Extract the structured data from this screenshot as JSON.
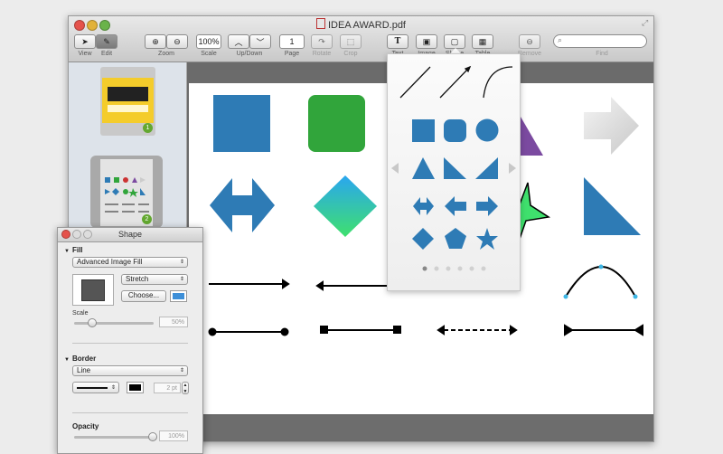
{
  "window": {
    "title": "IDEA AWARD.pdf"
  },
  "toolbar": {
    "labels": {
      "view": "View",
      "edit": "Edit",
      "zoom": "Zoom",
      "scale": "Scale",
      "updown": "Up/Down",
      "page": "Page",
      "rotate": "Rotate",
      "crop": "Crop",
      "text": "Text",
      "image": "Image",
      "shape": "Shape",
      "table": "Table",
      "remove": "Remove",
      "find": "Find"
    },
    "scale_value": "100%",
    "page_value": "1"
  },
  "inspector": {
    "title": "Shape",
    "fill_header": "Fill",
    "fill_type": "Advanced Image Fill",
    "fill_mode": "Stretch",
    "choose_label": "Choose...",
    "scale_label": "Scale",
    "scale_value": "50%",
    "border_header": "Border",
    "border_type": "Line",
    "border_width": "2 pt",
    "opacity_label": "Opacity",
    "opacity_value": "100%"
  },
  "sidebar": {
    "thumbnails": [
      {
        "page_badge": "1"
      },
      {
        "page_badge": "2"
      }
    ]
  },
  "popover": {
    "page_count": 6,
    "current_page": 1
  },
  "colors": {
    "shape_blue": "#2e7bb5",
    "shape_green": "#31a53b",
    "shape_purple": "#7b4aa0",
    "swatch_blue": "#3d8fd8"
  }
}
